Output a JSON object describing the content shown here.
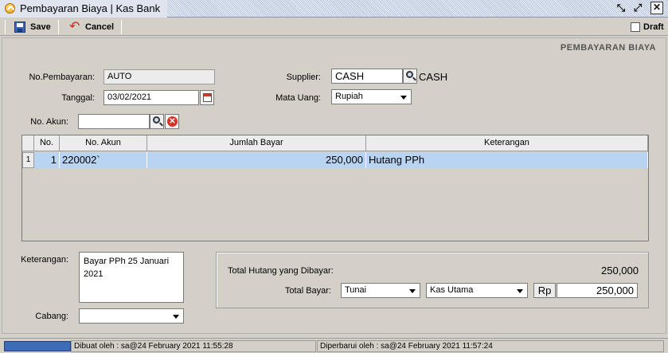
{
  "window": {
    "title": "Pembayaran Biaya | Kas Bank"
  },
  "toolbar": {
    "save_label": "Save",
    "cancel_label": "Cancel",
    "draft_label": "Draft"
  },
  "form": {
    "header": "PEMBAYARAN BIAYA",
    "no_pembayaran_label": "No.Pembayaran:",
    "no_pembayaran_value": "AUTO",
    "tanggal_label": "Tanggal:",
    "tanggal_value": "03/02/2021",
    "supplier_label": "Supplier:",
    "supplier_value": "CASH",
    "supplier_name": "CASH",
    "mata_uang_label": "Mata Uang:",
    "mata_uang_value": "Rupiah",
    "no_akun_label": "No. Akun:",
    "no_akun_value": ""
  },
  "table": {
    "columns": [
      "No.",
      "No. Akun",
      "Jumlah Bayar",
      "Keterangan"
    ],
    "rows": [
      {
        "row_num": "1",
        "no": "1",
        "akun": "220002`",
        "jumlah": "250,000",
        "keterangan": "Hutang PPh"
      }
    ]
  },
  "footer": {
    "keterangan_label": "Keterangan:",
    "keterangan_value": "Bayar PPh 25 Januari 2021",
    "cabang_label": "Cabang:",
    "cabang_value": "",
    "total_hutang_label": "Total Hutang yang Dibayar:",
    "total_hutang_value": "250,000",
    "total_bayar_label": "Total Bayar:",
    "payment_type": "Tunai",
    "kas_account": "Kas Utama",
    "currency_symbol": "Rp",
    "total_bayar_value": "250,000"
  },
  "status": {
    "created": "Dibuat oleh : sa@24 February 2021  11:55:28",
    "updated": "Diperbarui oleh : sa@24 February 2021  11:57:24"
  }
}
